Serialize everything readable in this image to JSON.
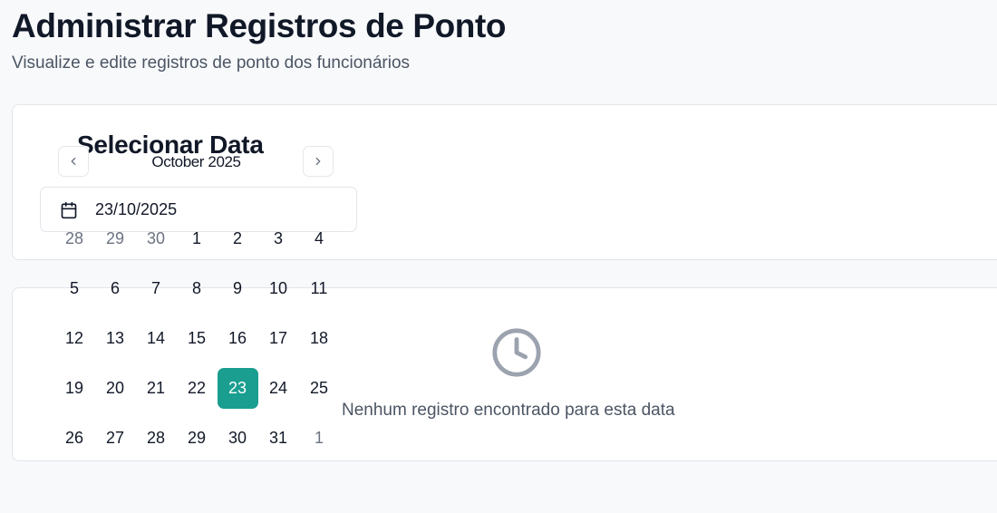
{
  "header": {
    "title": "Administrar Registros de Ponto",
    "subtitle": "Visualize e edite registros de ponto dos funcionários"
  },
  "date_picker": {
    "section_title": "Selecionar Data",
    "month_label": "October 2025",
    "selected_date": "23/10/2025",
    "prev_icon": "chevron-left-icon",
    "next_icon": "chevron-right-icon",
    "input_icon": "calendar-icon",
    "accent_color": "#1a9e8f",
    "weeks": [
      [
        {
          "d": "28",
          "outside": true
        },
        {
          "d": "29",
          "outside": true
        },
        {
          "d": "30",
          "outside": true
        },
        {
          "d": "1"
        },
        {
          "d": "2"
        },
        {
          "d": "3"
        },
        {
          "d": "4"
        }
      ],
      [
        {
          "d": "5"
        },
        {
          "d": "6"
        },
        {
          "d": "7"
        },
        {
          "d": "8"
        },
        {
          "d": "9"
        },
        {
          "d": "10"
        },
        {
          "d": "11"
        }
      ],
      [
        {
          "d": "12"
        },
        {
          "d": "13"
        },
        {
          "d": "14"
        },
        {
          "d": "15"
        },
        {
          "d": "16"
        },
        {
          "d": "17"
        },
        {
          "d": "18"
        }
      ],
      [
        {
          "d": "19"
        },
        {
          "d": "20"
        },
        {
          "d": "21"
        },
        {
          "d": "22"
        },
        {
          "d": "23",
          "selected": true
        },
        {
          "d": "24"
        },
        {
          "d": "25"
        }
      ],
      [
        {
          "d": "26"
        },
        {
          "d": "27"
        },
        {
          "d": "28"
        },
        {
          "d": "29"
        },
        {
          "d": "30"
        },
        {
          "d": "31"
        },
        {
          "d": "1",
          "outside": true
        }
      ]
    ]
  },
  "records": {
    "empty_icon": "clock-icon",
    "empty_message": "Nenhum registro encontrado para esta data"
  }
}
